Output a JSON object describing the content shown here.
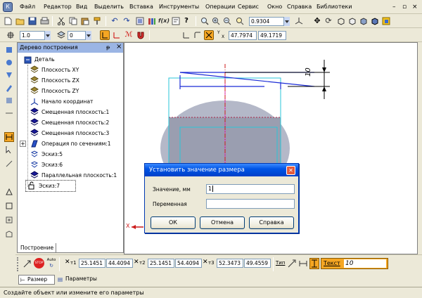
{
  "menu": {
    "items": [
      "Файл",
      "Редактор",
      "Вид",
      "Выделить",
      "Вставка",
      "Инструменты",
      "Операции",
      "Сервис",
      "Окно",
      "Справка",
      "Библиотеки"
    ]
  },
  "toolbar": {
    "zoom_value": "0.9304",
    "line_width": "1.0",
    "layer": "0",
    "coord_x": "47.7974",
    "coord_y": "49.1719",
    "coord_x_label": "X",
    "coord_y_label": "Y"
  },
  "tree_panel": {
    "title": "Дерево построения",
    "pin_glyph": "ᵽ",
    "close_glyph": "×",
    "root_label": "Деталь",
    "items": [
      {
        "label": "Плоскость XY",
        "icon": "plane-icon"
      },
      {
        "label": "Плоскость ZX",
        "icon": "plane-icon"
      },
      {
        "label": "Плоскость ZY",
        "icon": "plane-icon"
      },
      {
        "label": "Начало координат",
        "icon": "origin-icon"
      },
      {
        "label": "Смещенная плоскость:1",
        "icon": "offset-plane-icon"
      },
      {
        "label": "Смещенная плоскость:2",
        "icon": "offset-plane-icon"
      },
      {
        "label": "Смещенная плоскость:3",
        "icon": "offset-plane-icon"
      },
      {
        "label": "Операция по сечениям:1",
        "icon": "loft-icon"
      },
      {
        "label": "Эскиз:5",
        "icon": "sketch-icon"
      },
      {
        "label": "Эскиз:6",
        "icon": "sketch-icon"
      },
      {
        "label": "Параллельная плоскость:1",
        "icon": "offset-plane-icon"
      },
      {
        "label": "Эскиз:7",
        "icon": "sketch-edit-icon"
      }
    ],
    "tab_label": "Построение"
  },
  "canvas": {
    "dimension_value": "10",
    "axis_label": "X"
  },
  "dialog": {
    "title": "Установить значение размера",
    "close_glyph": "✕",
    "value_label": "Значение, мм",
    "value_input": "1",
    "variable_label": "Переменная",
    "variable_input": "",
    "ok_label": "ОК",
    "cancel_label": "Отмена",
    "help_label": "Справка"
  },
  "property_bar": {
    "t1_label": "т1",
    "t1_x": "25.1451",
    "t1_y": "44.4094",
    "t2_label": "т2",
    "t2_x": "25.1451",
    "t2_y": "54.4094",
    "t3_label": "т3",
    "t3_x": "52.3473",
    "t3_y": "49.4559",
    "type_label": "Тип",
    "text_label": "Текст",
    "text_value": "10",
    "stop_label": "STOP",
    "auto_label": "Auto",
    "tabs": [
      "Размер",
      "Параметры"
    ]
  },
  "status_bar": {
    "text": "Создайте объект или измените его параметры"
  },
  "colors": {
    "titlebar": "#0a246a",
    "dialog_title": "#0055e5",
    "panel_header": "#9bb5e4",
    "accent_orange": "#f5a623"
  }
}
